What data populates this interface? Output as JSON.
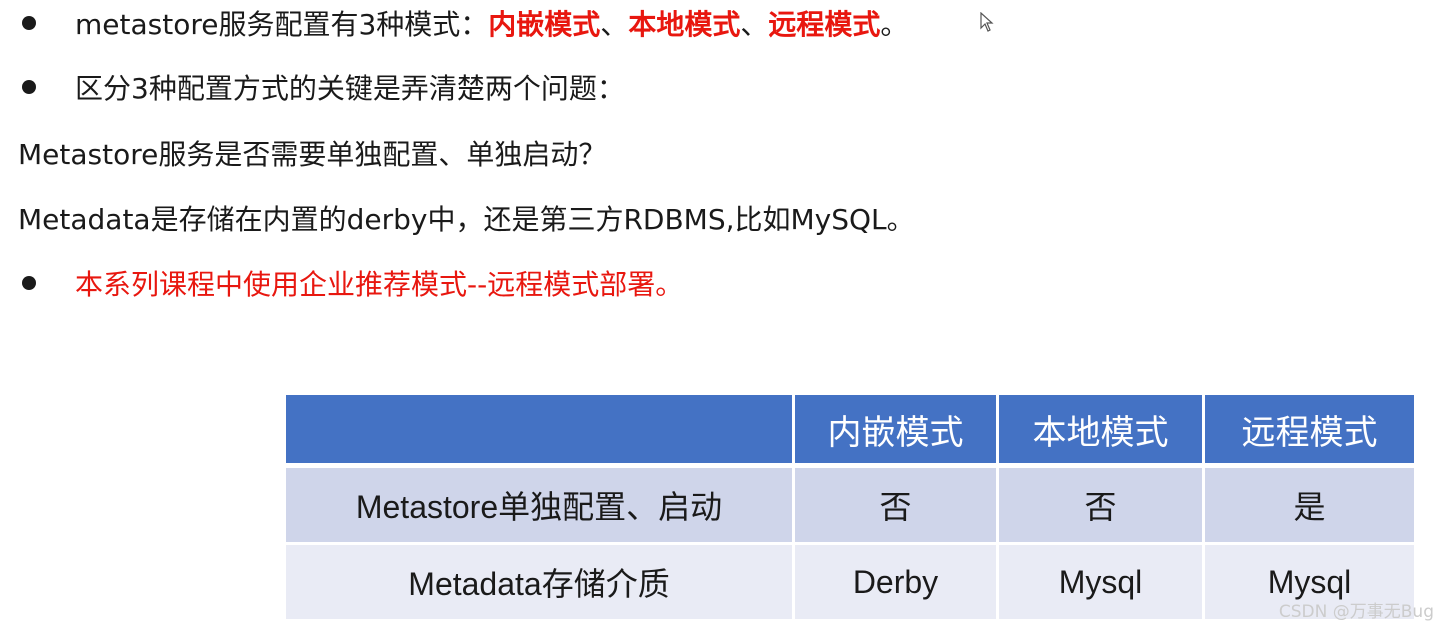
{
  "bullets": {
    "line1": {
      "prefix": "metastore服务配置有3种模式：",
      "mode1": "内嵌模式",
      "sep1": "、",
      "mode2": "本地模式",
      "sep2": "、",
      "mode3": "远程模式",
      "suffix": "。"
    },
    "line2": "区分3种配置方式的关键是弄清楚两个问题：",
    "question1": "Metastore服务是否需要单独配置、单独启动？",
    "question2": "Metadata是存储在内置的derby中，还是第三方RDBMS,比如MySQL。",
    "line3": "本系列课程中使用企业推荐模式--远程模式部署。"
  },
  "table": {
    "headers": [
      "",
      "内嵌模式",
      "本地模式",
      "远程模式"
    ],
    "rows": [
      [
        "Metastore单独配置、启动",
        "否",
        "否",
        "是"
      ],
      [
        "Metadata存储介质",
        "Derby",
        "Mysql",
        "Mysql"
      ]
    ]
  },
  "watermark": "CSDN @万事无Bug",
  "colors": {
    "highlight": "#e8170f",
    "table_header": "#4472c4",
    "table_row1": "#cfd5ea",
    "table_row2": "#e9ebf5"
  }
}
